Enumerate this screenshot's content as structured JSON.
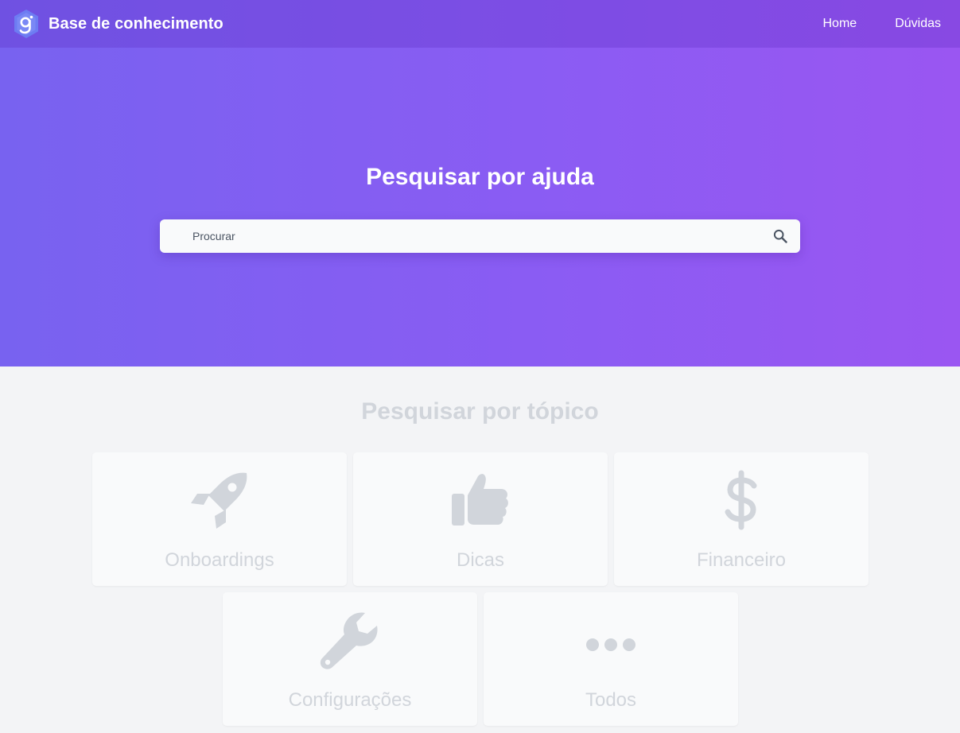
{
  "navbar": {
    "logo_icon": "hexagon-g-logo-icon",
    "brand_title": "Base de conhecimento",
    "links": [
      {
        "label": "Home"
      },
      {
        "label": "Dúvidas"
      }
    ]
  },
  "hero": {
    "title": "Pesquisar por ajuda",
    "search": {
      "placeholder": "Procurar",
      "value": "",
      "icon": "search-icon"
    }
  },
  "topics": {
    "title": "Pesquisar por tópico",
    "cards": [
      {
        "label": "Onboardings",
        "icon": "rocket-icon"
      },
      {
        "label": "Dicas",
        "icon": "thumbs-up-icon"
      },
      {
        "label": "Financeiro",
        "icon": "dollar-icon"
      },
      {
        "label": "Configurações",
        "icon": "wrench-icon"
      },
      {
        "label": "Todos",
        "icon": "ellipsis-icon"
      }
    ]
  },
  "colors": {
    "hero_gradient_start": "#7862f0",
    "hero_gradient_end": "#9a56f2",
    "page_background": "#f3f4f6",
    "card_background": "#f9fafb",
    "muted_icon": "#d1d5db"
  }
}
